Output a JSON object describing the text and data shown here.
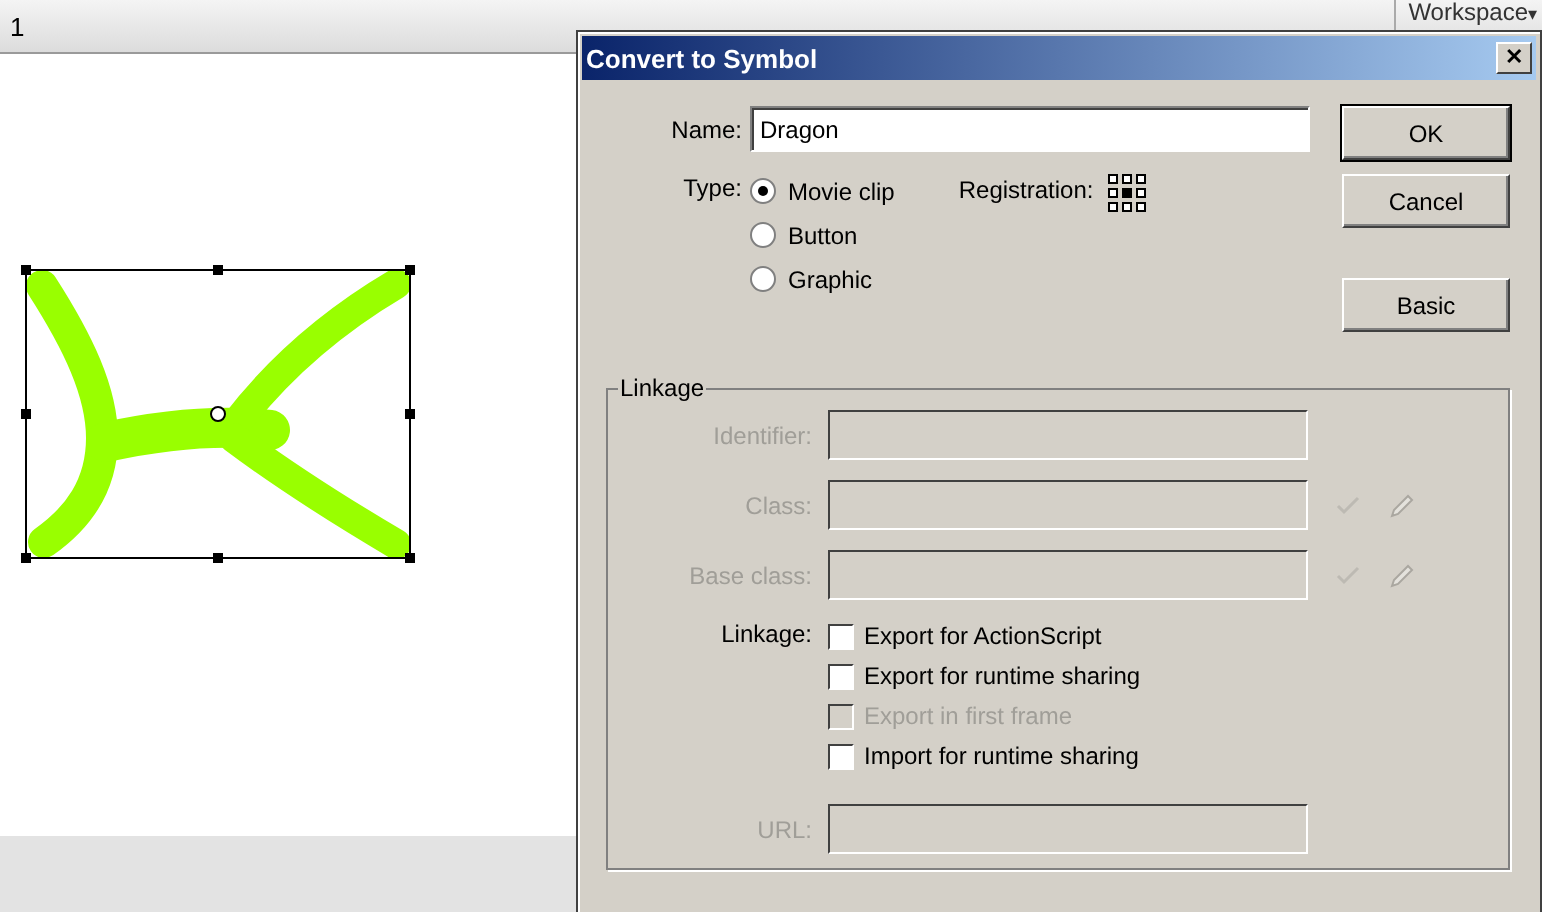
{
  "topbar": {
    "frame_label": "1",
    "workspace_button": "Workspace",
    "workspace_caret": "▾"
  },
  "dialog": {
    "title": "Convert to Symbol",
    "close": "✕",
    "name_label": "Name:",
    "name_value": "Dragon",
    "type_label": "Type:",
    "types": [
      {
        "label": "Movie clip",
        "selected": true
      },
      {
        "label": "Button",
        "selected": false
      },
      {
        "label": "Graphic",
        "selected": false
      }
    ],
    "registration_label": "Registration:",
    "buttons": [
      "OK",
      "Cancel",
      "Basic"
    ],
    "linkage": {
      "legend": "Linkage",
      "fields": [
        {
          "label": "Identifier:",
          "disabled": true,
          "kind": "plain"
        },
        {
          "label": "Class:",
          "disabled": true,
          "kind": "editable"
        },
        {
          "label": "Base class:",
          "disabled": true,
          "kind": "editable"
        }
      ],
      "checks_label": "Linkage:",
      "checks": [
        {
          "label": "Export for ActionScript",
          "checked": false,
          "disabled": false
        },
        {
          "label": "Export for runtime sharing",
          "checked": false,
          "disabled": false
        },
        {
          "label": "Export in first frame",
          "checked": false,
          "disabled": true
        },
        {
          "label": "Import for runtime sharing",
          "checked": false,
          "disabled": false
        }
      ],
      "url": {
        "label": "URL:",
        "disabled": true
      }
    }
  }
}
